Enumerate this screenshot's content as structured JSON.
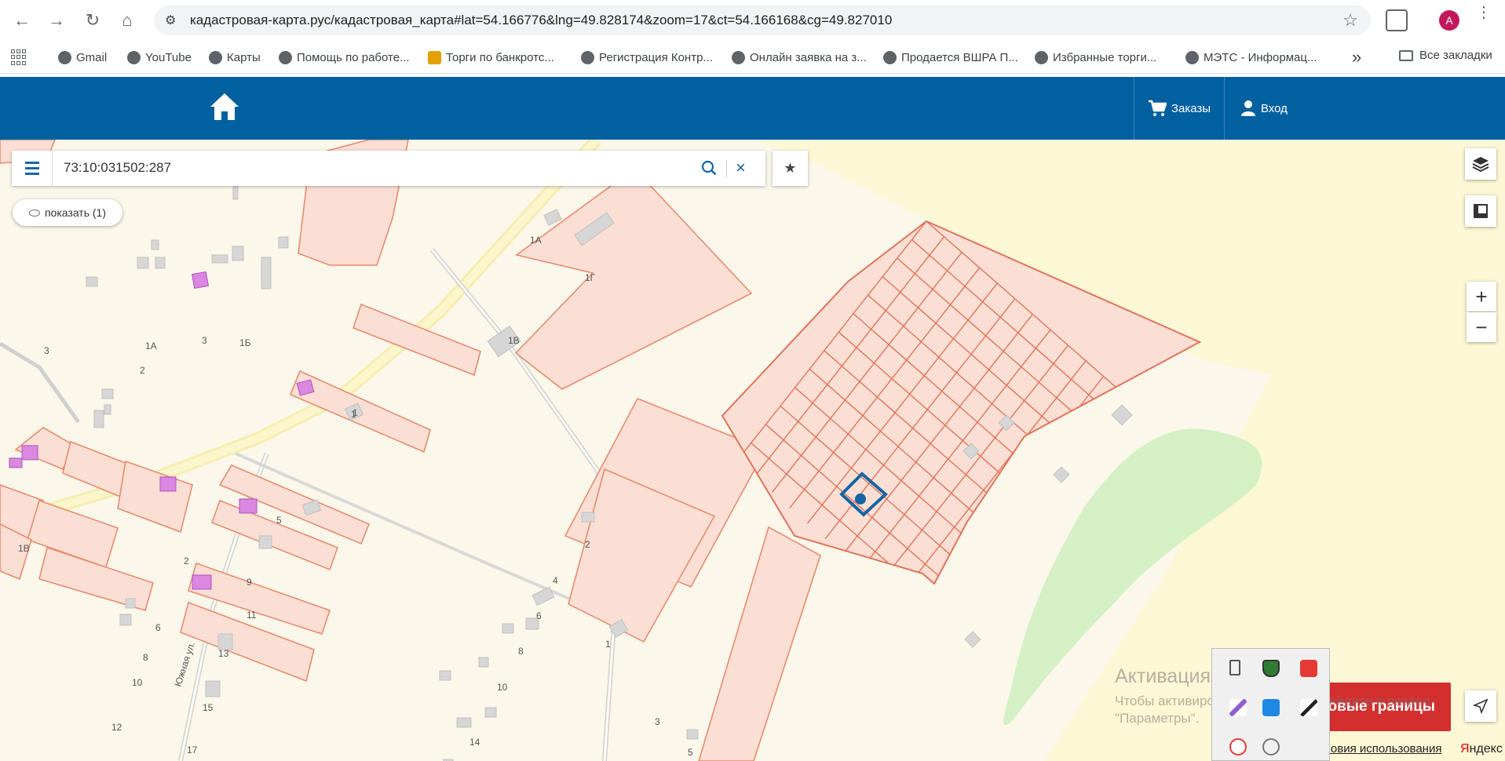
{
  "browser": {
    "url": "кадастровая-карта.рус/кадастровая_карта#lat=54.166776&lng=49.828174&zoom=17&ct=54.166168&cg=49.827010",
    "profile_initial": "A"
  },
  "bookmarks": [
    {
      "label": "Gmail",
      "icon": "gmail-icon"
    },
    {
      "label": "YouTube",
      "icon": "youtube-icon"
    },
    {
      "label": "Карты",
      "icon": "globe-icon"
    },
    {
      "label": "Помощь по работе...",
      "icon": "globe-icon"
    },
    {
      "label": "Торги по банкротс...",
      "icon": "hammer-icon"
    },
    {
      "label": "Регистрация Контр...",
      "icon": "globe-icon"
    },
    {
      "label": "Онлайн заявка на з...",
      "icon": "globe-icon"
    },
    {
      "label": "Продается ВШРА П...",
      "icon": "globe-icon"
    },
    {
      "label": "Избранные торги...",
      "icon": "globe-icon"
    },
    {
      "label": "МЭТС - Информац...",
      "icon": "globe-icon"
    }
  ],
  "bookmarks_more": "»",
  "bookmarks_all": "Все закладки",
  "header": {
    "orders_label": "Заказы",
    "login_label": "Вход",
    "brand_color": "#0060a0"
  },
  "search": {
    "value": "73:10:031502:287"
  },
  "show_pill": "показать (1)",
  "zoom_in": "+",
  "zoom_out": "−",
  "borders_button": "ровые границы",
  "windows_activation": {
    "title": "Активация Windows",
    "line1": "Чтобы активировать Windows, перейдите в раздел",
    "line2": "\"Параметры\"."
  },
  "terms_link": "ловия использования",
  "yandex": {
    "first": "Я",
    "rest": "ндекс"
  },
  "map_labels": [
    {
      "text": "1А"
    },
    {
      "text": "1Г"
    },
    {
      "text": "1В"
    },
    {
      "text": "1Б"
    },
    {
      "text": "1А"
    },
    {
      "text": "3"
    },
    {
      "text": "2"
    },
    {
      "text": "3"
    },
    {
      "text": "1"
    },
    {
      "text": "5"
    },
    {
      "text": "2"
    },
    {
      "text": "2"
    },
    {
      "text": "1"
    },
    {
      "text": "6"
    },
    {
      "text": "8"
    },
    {
      "text": "10"
    },
    {
      "text": "9"
    },
    {
      "text": "11"
    },
    {
      "text": "13"
    },
    {
      "text": "12"
    },
    {
      "text": "17"
    },
    {
      "text": "15"
    },
    {
      "text": "4"
    },
    {
      "text": "6"
    },
    {
      "text": "8"
    },
    {
      "text": "10"
    },
    {
      "text": "14"
    },
    {
      "text": "3"
    },
    {
      "text": "5"
    },
    {
      "text": "1"
    },
    {
      "text": "Южная ул."
    },
    {
      "text": "1В"
    }
  ]
}
